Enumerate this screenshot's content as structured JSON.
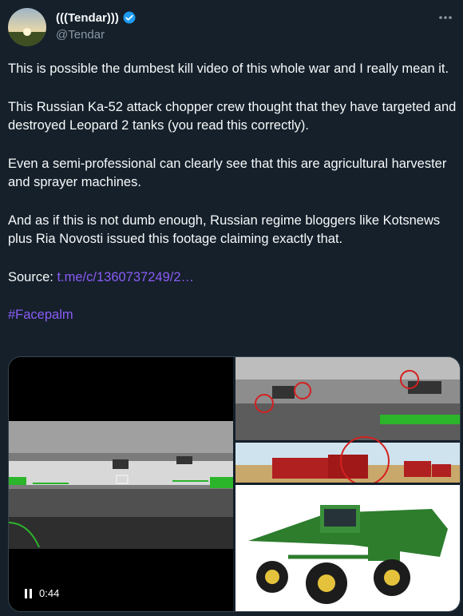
{
  "author": {
    "display_name": "(((Tendar)))",
    "handle": "@Tendar",
    "verified": true
  },
  "tweet": {
    "p1": "This is possible the dumbest kill video of this whole war and I really mean it.",
    "p2": "This Russian Ka-52 attack chopper crew thought that they have targeted and destroyed Leopard 2 tanks (you read this correctly).",
    "p3": "Even a semi-professional can clearly see that this are agricultural harvester and sprayer machines.",
    "p4": "And as if this is not dumb enough, Russian regime bloggers like Kotsnews plus Ria Novosti issued this footage claiming exactly that.",
    "source_label": "Source:",
    "source_link": "t.me/c/1360737249/2…",
    "hashtag": "#Facepalm"
  },
  "media": {
    "video_time": "0:44"
  },
  "colors": {
    "background": "#15202b",
    "link": "#8b5cf6",
    "verified": "#1d9bf0"
  },
  "icons": {
    "verified": "verified-badge-icon",
    "more": "more-options-icon",
    "pause": "pause-icon"
  }
}
